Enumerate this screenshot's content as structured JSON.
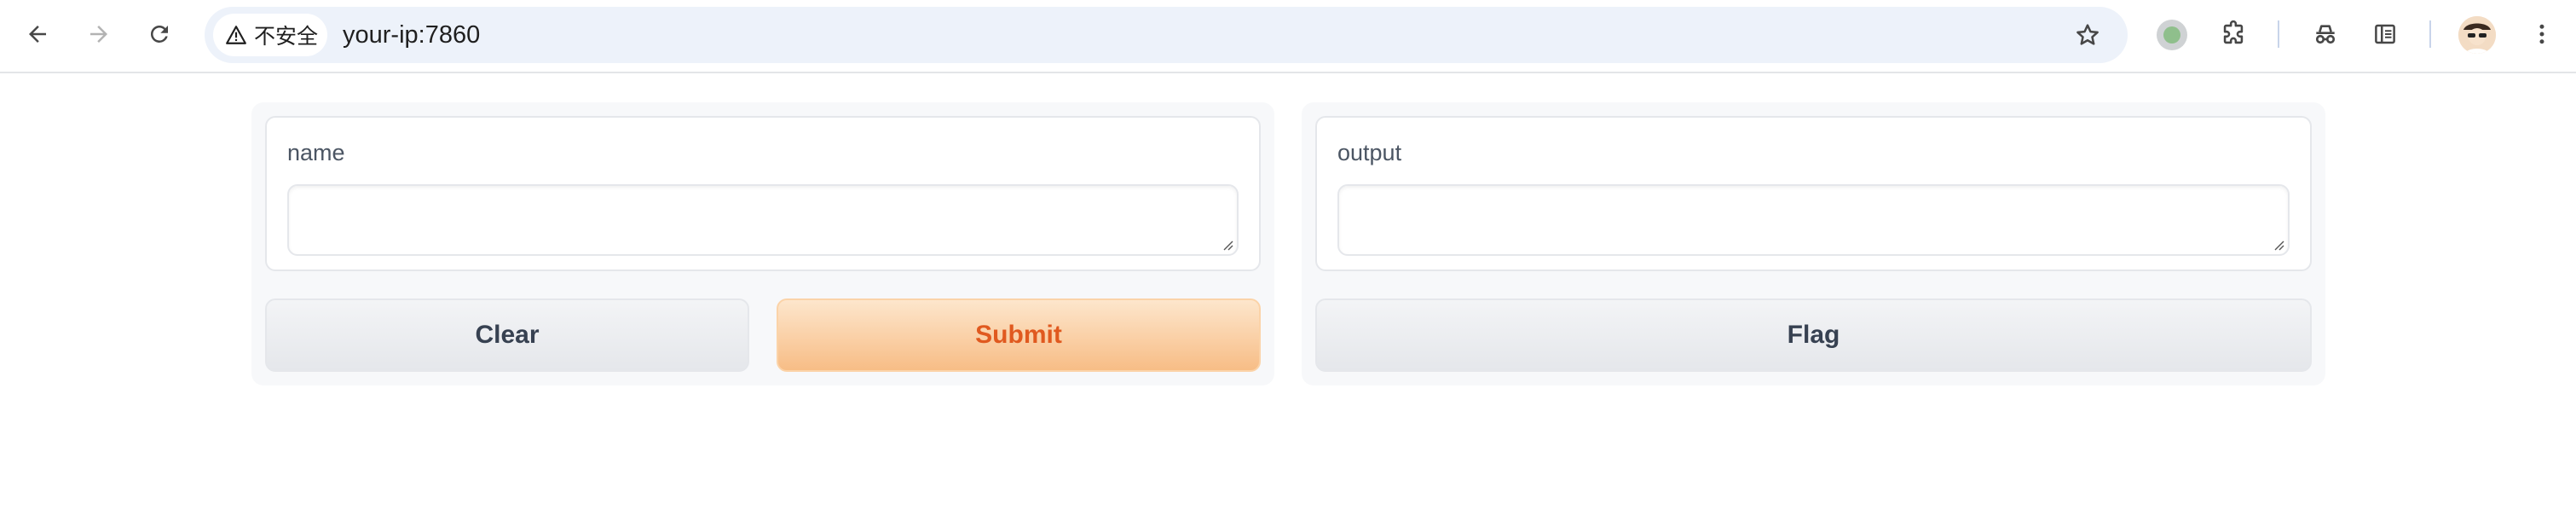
{
  "browser": {
    "security_label": "不安全",
    "url": "your-ip:7860",
    "icons": {
      "back": "arrow-left-icon",
      "forward": "arrow-right-icon",
      "reload": "reload-icon",
      "warning": "warning-triangle-icon",
      "bookmark": "star-icon",
      "extension_status": "green-dot-icon",
      "extensions": "puzzle-icon",
      "incognito": "spy-icon",
      "reading_list": "sidebar-icon",
      "profile": "avatar",
      "menu": "kebab-menu-icon"
    }
  },
  "app": {
    "input": {
      "label": "name",
      "value": ""
    },
    "output": {
      "label": "output",
      "value": ""
    },
    "buttons": {
      "clear": "Clear",
      "submit": "Submit",
      "flag": "Flag"
    }
  },
  "colors": {
    "primary_text": "#e0591f",
    "primary_bg_top": "#fde6cc",
    "primary_bg_bottom": "#f7bd86",
    "secondary_text": "#374151",
    "label_text": "#4b5563",
    "omnibox_bg": "#edf2fa"
  }
}
